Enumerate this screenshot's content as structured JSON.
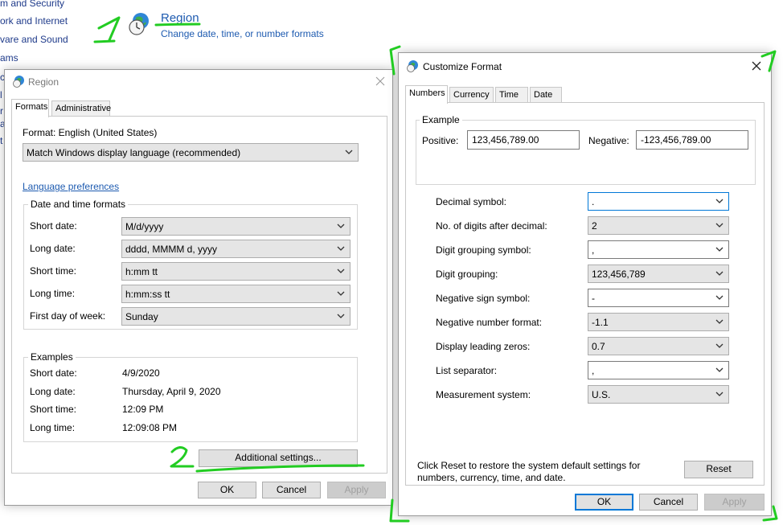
{
  "control_panel": {
    "left_items": [
      "m and Security",
      "ork and Internet",
      "vare and Sound",
      "ams",
      "c",
      "l",
      "r",
      "a",
      "t"
    ],
    "region_title": "Region",
    "region_subtitle": "Change date, time, or number formats"
  },
  "region_dialog": {
    "title": "Region",
    "tabs": [
      "Formats",
      "Administrative"
    ],
    "format_label": "Format: English (United States)",
    "format_value": "Match Windows display language (recommended)",
    "language_link": "Language preferences",
    "date_time_group": "Date and time formats",
    "fields": [
      {
        "label": "Short date:",
        "value": "M/d/yyyy"
      },
      {
        "label": "Long date:",
        "value": "dddd, MMMM d, yyyy"
      },
      {
        "label": "Short time:",
        "value": "h:mm tt"
      },
      {
        "label": "Long time:",
        "value": "h:mm:ss tt"
      },
      {
        "label": "First day of week:",
        "value": "Sunday"
      }
    ],
    "examples_group": "Examples",
    "examples": [
      {
        "label": "Short date:",
        "value": "4/9/2020"
      },
      {
        "label": "Long date:",
        "value": "Thursday, April 9, 2020"
      },
      {
        "label": "Short time:",
        "value": "12:09 PM"
      },
      {
        "label": "Long time:",
        "value": "12:09:08 PM"
      }
    ],
    "additional_settings": "Additional settings...",
    "ok": "OK",
    "cancel": "Cancel",
    "apply": "Apply"
  },
  "customize_dialog": {
    "title": "Customize Format",
    "tabs": [
      "Numbers",
      "Currency",
      "Time",
      "Date"
    ],
    "example_group": "Example",
    "positive_label": "Positive:",
    "positive_value": "123,456,789.00",
    "negative_label": "Negative:",
    "negative_value": "-123,456,789.00",
    "settings": [
      {
        "label": "Decimal symbol:",
        "value": "."
      },
      {
        "label": "No. of digits after decimal:",
        "value": "2"
      },
      {
        "label": "Digit grouping symbol:",
        "value": ","
      },
      {
        "label": "Digit grouping:",
        "value": "123,456,789"
      },
      {
        "label": "Negative sign symbol:",
        "value": "-"
      },
      {
        "label": "Negative number format:",
        "value": "-1.1"
      },
      {
        "label": "Display leading zeros:",
        "value": "0.7"
      },
      {
        "label": "List separator:",
        "value": ","
      },
      {
        "label": "Measurement system:",
        "value": "U.S."
      }
    ],
    "reset_info": "Click Reset to restore the system default settings for numbers, currency, time, and date.",
    "reset": "Reset",
    "ok": "OK",
    "cancel": "Cancel",
    "apply": "Apply"
  },
  "annotations": {
    "step1": "1",
    "step2": "2",
    "color": "#22cc22"
  },
  "colors": {
    "link": "#1e5bb0",
    "accent": "#0078d7"
  }
}
